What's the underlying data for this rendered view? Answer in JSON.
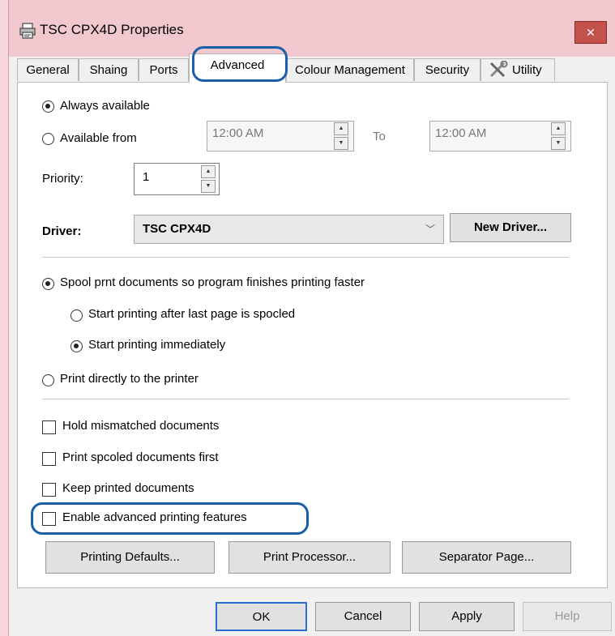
{
  "window": {
    "title": "TSC CPX4D Properties",
    "close_glyph": "✕",
    "printer_icon": "printer-icon"
  },
  "tabs": [
    {
      "label": "General"
    },
    {
      "label": "Shaing"
    },
    {
      "label": "Ports"
    },
    {
      "label": "Advanced"
    },
    {
      "label": "Colour Management"
    },
    {
      "label": "Security"
    },
    {
      "label": "Utility",
      "icon": "tools-icon"
    }
  ],
  "availability": {
    "always_label": "Always available",
    "always_selected": true,
    "from_label": "Available from",
    "from_selected": false,
    "from_time": "12:00 AM",
    "to_label": "To",
    "to_time": "12:00 AM"
  },
  "priority": {
    "label": "Priority:",
    "value": "1"
  },
  "driver": {
    "label": "Driver:",
    "value": "TSC CPX4D",
    "new_driver_label": "New Driver..."
  },
  "spool": {
    "spool_label": "Spool prnt documents so program finishes printing faster",
    "spool_selected": true,
    "after_last_label": "Start printing after last page is spocled",
    "after_last_selected": false,
    "immediately_label": "Start printing immediately",
    "immediately_selected": true,
    "direct_label": "Print directly to the printer",
    "direct_selected": false
  },
  "options": [
    {
      "label": "Hold mismatched documents",
      "checked": false
    },
    {
      "label": "Print spcoled documents first",
      "checked": false
    },
    {
      "label": "Keep printed documents",
      "checked": false
    },
    {
      "label": "Enable advanced printing features",
      "checked": false
    }
  ],
  "panel_buttons": {
    "defaults": "Printing Defaults...",
    "processor": "Print Processor...",
    "separator": "Separator Page..."
  },
  "footer": {
    "ok": "OK",
    "cancel": "Cancel",
    "apply": "Apply",
    "help": "Help"
  },
  "colors": {
    "highlight": "#1a5fa8",
    "title_bar": "#f0c8cd",
    "close": "#c4524c"
  }
}
